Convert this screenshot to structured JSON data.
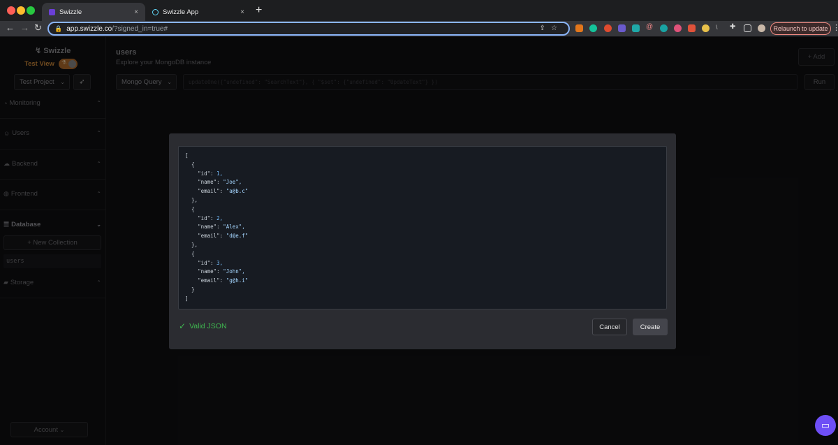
{
  "browser": {
    "tabs": [
      {
        "label": "Swizzle",
        "active": true
      },
      {
        "label": "Swizzle App",
        "active": false
      }
    ],
    "close_glyph": "×",
    "new_tab_glyph": "+",
    "url_host": "app.swizzle.co",
    "url_path": "/?signed_in=true#",
    "relaunch_label": "Relaunch to update"
  },
  "sidebar": {
    "logo": "Swizzle",
    "test_view_label": "Test View",
    "project": "Test Project",
    "sections": [
      "Monitoring",
      "Users",
      "Backend",
      "Frontend",
      "Database",
      "Storage"
    ],
    "new_collection_label": "+ New Collection",
    "collections": [
      "users"
    ],
    "account_label": "Account"
  },
  "main": {
    "title": "users",
    "subtitle": "Explore your MongoDB instance",
    "add_label": "+ Add",
    "query_type": "Mongo Query",
    "query_placeholder": "updateOne({\"undefined\": \"SearchText\"}, { \"$set\": {\"undefined\": \"UpdateText\"} })",
    "run_label": "Run"
  },
  "modal": {
    "json_lines": [
      "[",
      "  {",
      "    \"id\": 1,",
      "    \"name\": \"Joe\",",
      "    \"email\": \"a@b.c\"",
      "  },",
      "  {",
      "    \"id\": 2,",
      "    \"name\": \"Alex\",",
      "    \"email\": \"d@e.f\"",
      "  },",
      "  {",
      "    \"id\": 3,",
      "    \"name\": \"John\",",
      "    \"email\": \"g@h.i\"",
      "  }",
      "]"
    ],
    "valid_label": "Valid JSON",
    "cancel_label": "Cancel",
    "create_label": "Create"
  },
  "colors": {
    "valid_green": "#3fb950",
    "accent_orange": "#d08a3a",
    "chat_purple": "#6e4ff6"
  }
}
